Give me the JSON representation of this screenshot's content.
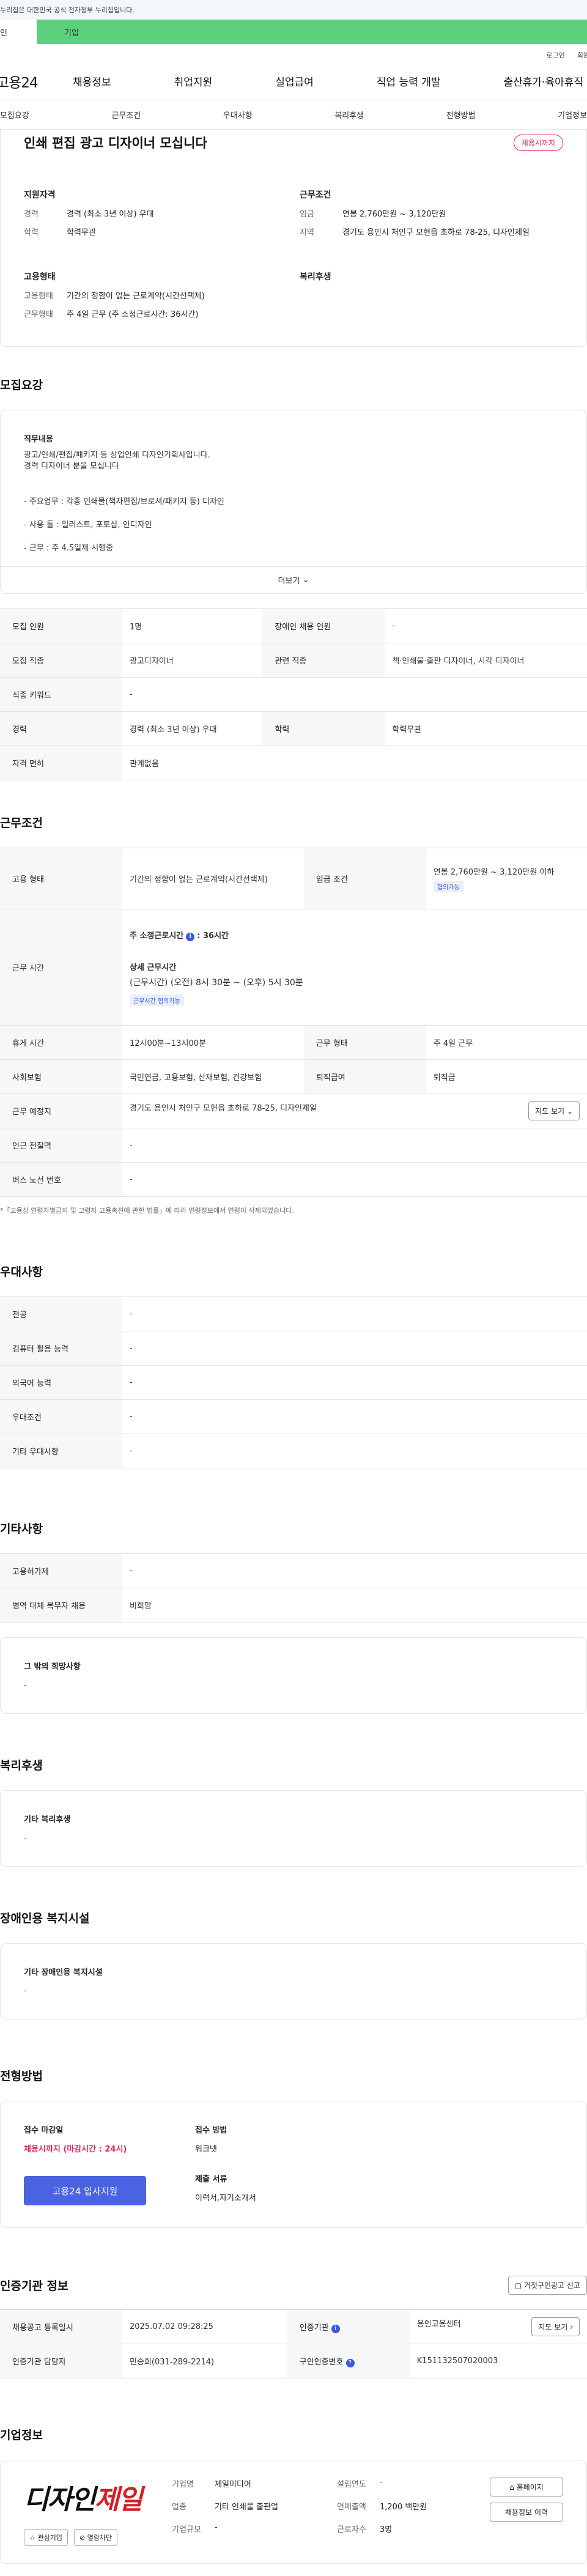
{
  "gov_banner": "누리집은 대한민국 공식 전자정부 누리집입니다.",
  "tabs": {
    "personal": "인",
    "corp": "기업"
  },
  "util": {
    "login": "로그인",
    "join": "회원"
  },
  "logo": "고용24",
  "gnb": [
    "채용정보",
    "취업지원",
    "실업급여",
    "직업 능력 개발",
    "출산휴가·육아휴직"
  ],
  "subnav": [
    "모집요강",
    "근무조건",
    "우대사항",
    "복리후생",
    "전형방법",
    "기업정보"
  ],
  "hero": {
    "title": "인쇄 편집 광고 디자이너 모십니다",
    "badge": "채용시까지",
    "qual_title": "지원자격",
    "qual": [
      {
        "k": "경력",
        "v": "경력 (최소 3년 이상) 우대"
      },
      {
        "k": "학력",
        "v": "학력무관"
      }
    ],
    "cond_title": "근무조건",
    "cond": [
      {
        "k": "임금",
        "v": "연봉 2,760만원 ~ 3,120만원"
      },
      {
        "k": "지역",
        "v": "경기도 용인시 처인구 모현읍 초하로 78-25, 디자인제일"
      }
    ],
    "emp_title": "고용형태",
    "emp": [
      {
        "k": "고용형태",
        "v": "기간의 정함이 없는 근로계약(시간선택제)"
      },
      {
        "k": "근무형태",
        "v": "주 4일 근무 (주 소정근로시간: 36시간)"
      }
    ],
    "welfare_title": "복리후생"
  },
  "recruit": {
    "title": "모집요강",
    "job_title": "직무내용",
    "job_lines": [
      "광고/인쇄/편집/패키지 등 상업인쇄 디자인기획사입니다.",
      "경력 디자이너 분을 모십니다"
    ],
    "bullets": [
      "- 주요업무 : 각종 인쇄물(책자편집/브로셔/패키지 등) 디자인",
      "- 사용 툴 : 일러스트, 포토샵, 인디자인",
      "- 근무 : 주 4.5일제 시행중"
    ],
    "more": "더보기",
    "rows": [
      {
        "k1": "모집 인원",
        "v1": "1명",
        "k2": "장애인 채용 인원",
        "v2": "-"
      },
      {
        "k1": "모집 직종",
        "v1": "광고디자이너",
        "k2": "관련 직종",
        "v2": "책·인쇄물·출판 디자이너, 시각 디자이너"
      },
      {
        "k1": "직종 키워드",
        "v1": "-"
      },
      {
        "k1": "경력",
        "v1": "경력 (최소 3년 이상) 우대",
        "k2": "학력",
        "v2": "학력무관"
      },
      {
        "k1": "자격 면허",
        "v1": "관계없음"
      }
    ]
  },
  "work": {
    "title": "근무조건",
    "emp_k": "고용 형태",
    "emp_v": "기간의 정함이 없는 근로계약(시간선택제)",
    "wage_k": "임금 조건",
    "wage_v": "연봉 2,760만원 ~ 3,120만원 이하",
    "wage_badge": "협의가능",
    "hours_k": "근무 시간",
    "hours_week": "주 소정근로시간",
    "hours_week_v": ": 36시간",
    "hours_detail_t": "상세 근무시간",
    "hours_detail": "(근무시간) (오전) 8시 30분 ~ (오후) 5시 30분",
    "hours_badge": "근무시간 협의가능",
    "rows": [
      {
        "k1": "휴게 시간",
        "v1": "12시00분~13시00분",
        "k2": "근무 형태",
        "v2": "주 4일 근무"
      },
      {
        "k1": "사회보험",
        "v1": "국민연금, 고용보험, 산재보험, 건강보험",
        "k2": "퇴직급여",
        "v2": "퇴직금"
      }
    ],
    "place_k": "근무 예정지",
    "place_v": "경기도 용인시 처인구 모현읍 초하로 78-25, 디자인제일",
    "map_btn": "지도 보기",
    "subway_k": "인근 전철역",
    "subway_v": "-",
    "bus_k": "버스 노선 번호",
    "bus_v": "-",
    "note": "「고용상 연령차별금지 및 고령자 고용촉진에 관한 법률」에 따라 연령정보에서 연령이 삭제되었습니다."
  },
  "pref": {
    "title": "우대사항",
    "rows": [
      {
        "k": "전공",
        "v": "-"
      },
      {
        "k": "컴퓨터 활용 능력",
        "v": "-"
      },
      {
        "k": "외국어 능력",
        "v": "-"
      },
      {
        "k": "우대조건",
        "v": "-"
      },
      {
        "k": "기타 우대사항",
        "v": "-"
      }
    ]
  },
  "etc": {
    "title": "기타사항",
    "rows": [
      {
        "k": "고용허가제",
        "v": "-"
      },
      {
        "k": "병역 대체 복무자 채용",
        "v": "비희망"
      }
    ],
    "box_t": "그 밖의 희망사항",
    "box_v": "-"
  },
  "welfare": {
    "title": "복리후생",
    "box_t": "기타 복리후생",
    "box_v": "-"
  },
  "disab": {
    "title": "장애인용 복지시설",
    "box_t": "기타 장애인용 복지시설",
    "box_v": "-"
  },
  "apply": {
    "title": "전형방법",
    "deadline_t": "접수 마감일",
    "deadline_v": "채용시까지 (마감시간 : 24시)",
    "method_t": "접수 방법",
    "method_v": "워크넷",
    "docs_t": "제출 서류",
    "docs_v": "이력서,자기소개서",
    "btn": "고용24 입사지원"
  },
  "cert": {
    "title": "인증기관 정보",
    "report_btn": "거짓구인광고 신고",
    "reg_k": "채용공고 등록일시",
    "reg_v": "2025.07.02 09:28:25",
    "org_k": "인증기관",
    "org_v": "용인고용센터",
    "map_btn": "지도 보기",
    "mgr_k": "인증기관 담당자",
    "mgr_v": "민승희(031-289-2214)",
    "no_k": "구인인증번호",
    "no_v": "K151132507020003"
  },
  "corp": {
    "title": "기업정보",
    "logo_a": "디자인",
    "logo_b": "제일",
    "fav": "관심기업",
    "block": "열람차단",
    "name_k": "기업명",
    "name_v": "제일미디어",
    "found_k": "설립연도",
    "found_v": "-",
    "ind_k": "업종",
    "ind_v": "기타 인쇄물 출판업",
    "rev_k": "연매출액",
    "rev_v": "1,200 백만원",
    "emp_k": "근로자수",
    "emp_v": "3명",
    "size_k": "기업규모",
    "size_v": "-",
    "home_btn": "홈페이지",
    "info_btn": "채용정보 이력"
  }
}
